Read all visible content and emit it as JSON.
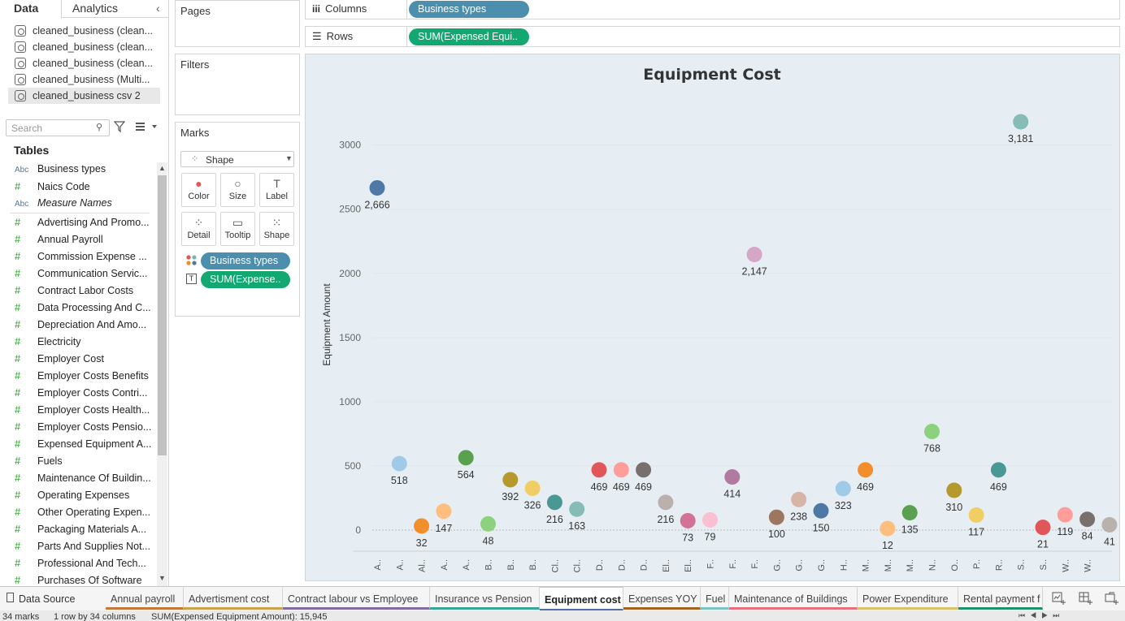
{
  "data_pane": {
    "tab_data": "Data",
    "tab_analytics": "Analytics",
    "collapse_icon": "chevron-left-icon",
    "datasources": [
      "cleaned_business (clean...",
      "cleaned_business (clean...",
      "cleaned_business (clean...",
      "cleaned_business (Multi...",
      "cleaned_business csv 2"
    ],
    "search_placeholder": "Search",
    "tables_heading": "Tables",
    "fields": [
      {
        "type": "Abc",
        "name": "Business types"
      },
      {
        "type": "#",
        "name": "Naics Code"
      },
      {
        "type": "Abc",
        "name": "Measure Names"
      },
      {
        "type": "#",
        "name": "Advertising And Promo..."
      },
      {
        "type": "#",
        "name": "Annual Payroll"
      },
      {
        "type": "#",
        "name": "Commission Expense ..."
      },
      {
        "type": "#",
        "name": "Communication Servic..."
      },
      {
        "type": "#",
        "name": "Contract Labor Costs"
      },
      {
        "type": "#",
        "name": "Data Processing And C..."
      },
      {
        "type": "#",
        "name": "Depreciation And Amo..."
      },
      {
        "type": "#",
        "name": "Electricity"
      },
      {
        "type": "#",
        "name": "Employer Cost"
      },
      {
        "type": "#",
        "name": "Employer Costs Benefits"
      },
      {
        "type": "#",
        "name": "Employer Costs Contri..."
      },
      {
        "type": "#",
        "name": "Employer Costs Health..."
      },
      {
        "type": "#",
        "name": "Employer Costs Pensio..."
      },
      {
        "type": "#",
        "name": "Expensed Equipment A..."
      },
      {
        "type": "#",
        "name": "Fuels"
      },
      {
        "type": "#",
        "name": "Maintenance Of Buildin..."
      },
      {
        "type": "#",
        "name": "Operating Expenses"
      },
      {
        "type": "#",
        "name": "Other Operating Expen..."
      },
      {
        "type": "#",
        "name": "Packaging Materials A..."
      },
      {
        "type": "#",
        "name": "Parts And Supplies Not..."
      },
      {
        "type": "#",
        "name": "Professional And Tech..."
      },
      {
        "type": "#",
        "name": "Purchases Of Software"
      }
    ]
  },
  "cards": {
    "pages": "Pages",
    "filters": "Filters",
    "marks": "Marks",
    "mark_type": "Shape",
    "buttons": [
      "Color",
      "Size",
      "Label",
      "Detail",
      "Tooltip",
      "Shape"
    ],
    "marks_pills": [
      "Business types",
      "SUM(Expense.."
    ]
  },
  "shelves": {
    "columns_label": "Columns",
    "columns_pill": "Business types",
    "rows_label": "Rows",
    "rows_pill": "SUM(Expensed Equi.."
  },
  "chart_data": {
    "type": "scatter",
    "title": "Equipment   Cost",
    "xlabel": "",
    "ylabel": "Equipment Amount",
    "ylim": [
      0,
      3200
    ],
    "yticks": [
      0,
      500,
      1000,
      1500,
      2000,
      2500,
      3000
    ],
    "grid": true,
    "legend": "none",
    "categories": [
      "A..",
      "A..",
      "Al..",
      "A..",
      "A..",
      "B..",
      "B..",
      "B..",
      "Cl..",
      "Cl..",
      "D..",
      "D..",
      "D..",
      "El..",
      "El..",
      "F..",
      "F..",
      "F..",
      "G..",
      "G..",
      "G..",
      "H..",
      "M..",
      "M..",
      "M..",
      "N..",
      "O..",
      "P..",
      "R..",
      "S..",
      "S..",
      "W..",
      "W.."
    ],
    "values": [
      2666,
      518,
      32,
      147,
      564,
      48,
      392,
      326,
      216,
      163,
      469,
      469,
      469,
      216,
      73,
      79,
      414,
      2147,
      100,
      238,
      150,
      323,
      469,
      12,
      135,
      768,
      310,
      117,
      469,
      3181,
      21,
      119,
      84,
      41
    ],
    "labels": [
      "2,666",
      "518",
      "32",
      "147",
      "564",
      "48",
      "392",
      "326",
      "216",
      "163",
      "469",
      "469",
      "469",
      "216",
      "73",
      "79",
      "414",
      "2,147",
      "100",
      "238",
      "150",
      "323",
      "469",
      "12",
      "135",
      "768",
      "310",
      "117",
      "469",
      "3,181",
      "21",
      "119",
      "84",
      "41"
    ],
    "colors": [
      "#4e79a7",
      "#a0cbe8",
      "#f28e2b",
      "#ffbe7d",
      "#59a14f",
      "#8cd17d",
      "#b6992d",
      "#f1ce63",
      "#499894",
      "#86bcb6",
      "#e15759",
      "#ff9d9a",
      "#79706e",
      "#bab0ac",
      "#d37295",
      "#fabfd2",
      "#b07aa1",
      "#d4a6c8",
      "#9d7660",
      "#d7b5a6",
      "#4e79a7",
      "#a0cbe8",
      "#f28e2b",
      "#ffbe7d",
      "#59a14f",
      "#8cd17d",
      "#b6992d",
      "#f1ce63",
      "#499894",
      "#86bcb6",
      "#e15759",
      "#ff9d9a",
      "#79706e",
      "#bab0ac"
    ]
  },
  "sheet_tabs": {
    "data_source": "Data Source",
    "tabs": [
      {
        "label": "Annual payroll",
        "color": "#c07a3c"
      },
      {
        "label": "Advertisment  cost",
        "color": "#c9a14a"
      },
      {
        "label": "Contract  labour vs Employee",
        "color": "#7e6ca0"
      },
      {
        "label": "Insurance  vs  Pension",
        "color": "#3aa39a"
      },
      {
        "label": "Equipment cost",
        "color": "#4f6fa1"
      },
      {
        "label": "Expenses  YOY",
        "color": "#a26420"
      },
      {
        "label": "Fuel",
        "color": "#7cc2c2"
      },
      {
        "label": "Maintenance of Buildings",
        "color": "#e2707f"
      },
      {
        "label": "Power  Expenditure",
        "color": "#d8c06b"
      },
      {
        "label": "Rental payment f",
        "color": "#1f8f6c"
      }
    ]
  },
  "status": {
    "marks": "34 marks",
    "rows": "1 row by 34 columns",
    "sum": "SUM(Expensed Equipment Amount): 15,945"
  }
}
